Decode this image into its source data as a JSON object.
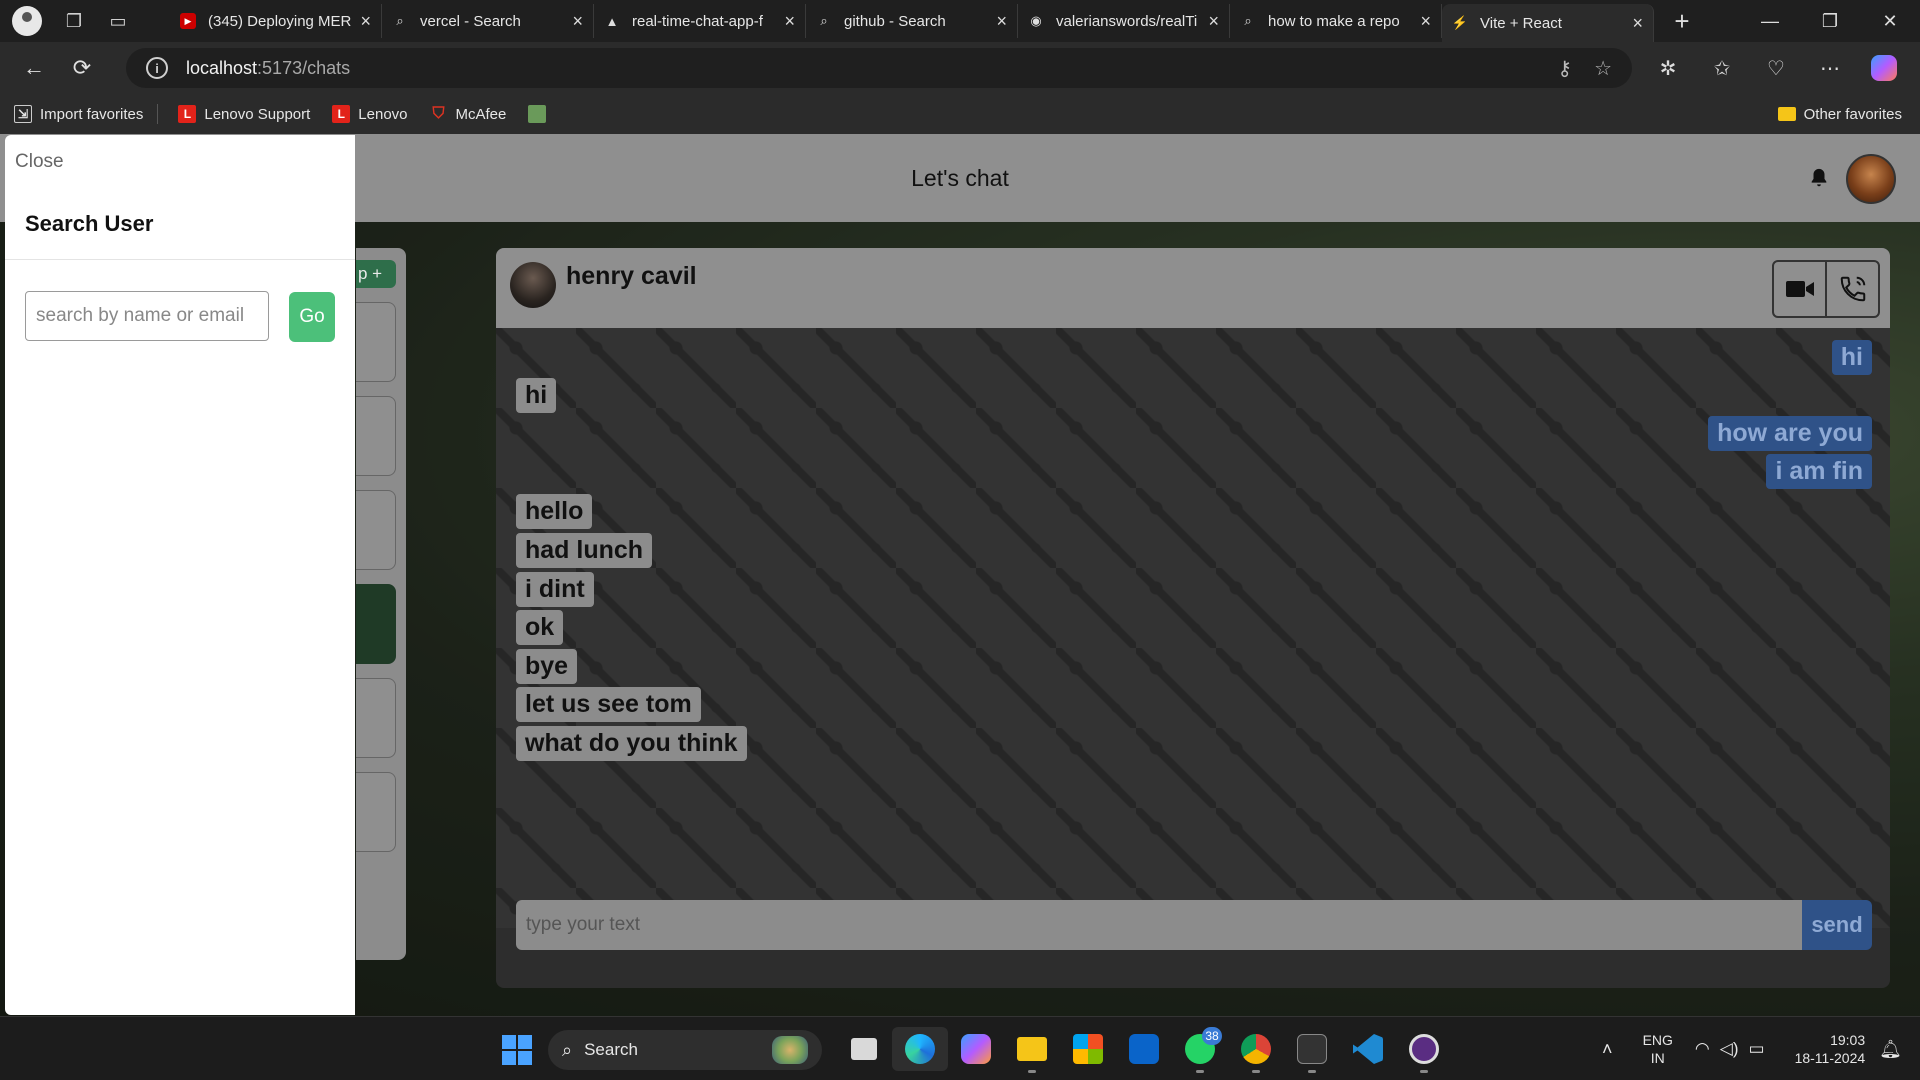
{
  "browser": {
    "tabs": [
      {
        "title": "(345) Deploying MERN",
        "icon": "youtube-icon",
        "active": false
      },
      {
        "title": "vercel - Search",
        "icon": "search-icon",
        "active": false
      },
      {
        "title": "real-time-chat-app-f",
        "icon": "vercel-icon",
        "active": false
      },
      {
        "title": "github - Search",
        "icon": "search-icon",
        "active": false
      },
      {
        "title": "valerianswords/realTi",
        "icon": "github-icon",
        "active": false
      },
      {
        "title": "how to make a repo",
        "icon": "search-icon",
        "active": false
      },
      {
        "title": "Vite + React",
        "icon": "vite-icon",
        "active": true
      }
    ],
    "url_host": "localhost",
    "url_path": ":5173/chats",
    "favorites": [
      {
        "label": "Import favorites",
        "icon": "import-icon"
      },
      {
        "label": "Lenovo Support",
        "icon": "lenovo-icon"
      },
      {
        "label": "Lenovo",
        "icon": "lenovo-icon"
      },
      {
        "label": "McAfee",
        "icon": "mcafee-icon"
      },
      {
        "label": "",
        "icon": "image-icon"
      }
    ],
    "other_favorites": "Other favorites"
  },
  "app": {
    "title": "Let's chat",
    "left_button": "p +",
    "chat": {
      "name": "henry cavil",
      "messages": [
        {
          "text": "hi",
          "dir": "out"
        },
        {
          "text": "hi",
          "dir": "in"
        },
        {
          "text": "how are you",
          "dir": "out"
        },
        {
          "text": "i am fin",
          "dir": "out"
        },
        {
          "text": "hello",
          "dir": "in"
        },
        {
          "text": "had lunch",
          "dir": "in"
        },
        {
          "text": "i dint",
          "dir": "in"
        },
        {
          "text": "ok",
          "dir": "in"
        },
        {
          "text": "bye",
          "dir": "in"
        },
        {
          "text": "let us see tom",
          "dir": "in"
        },
        {
          "text": "what do you think",
          "dir": "in"
        }
      ],
      "input_placeholder": "type your text",
      "send_label": "send"
    },
    "colors": {
      "incoming": "#8c8c8c",
      "outgoing": "#2f5288",
      "go": "#4cc07a"
    }
  },
  "drawer": {
    "close_label": "Close",
    "title": "Search User",
    "search_placeholder": "search by name or email",
    "go_label": "Go"
  },
  "taskbar": {
    "search_label": "Search",
    "whatsapp_badge": "38",
    "lang_line1": "ENG",
    "lang_line2": "IN",
    "time": "19:03",
    "date": "18-11-2024"
  }
}
